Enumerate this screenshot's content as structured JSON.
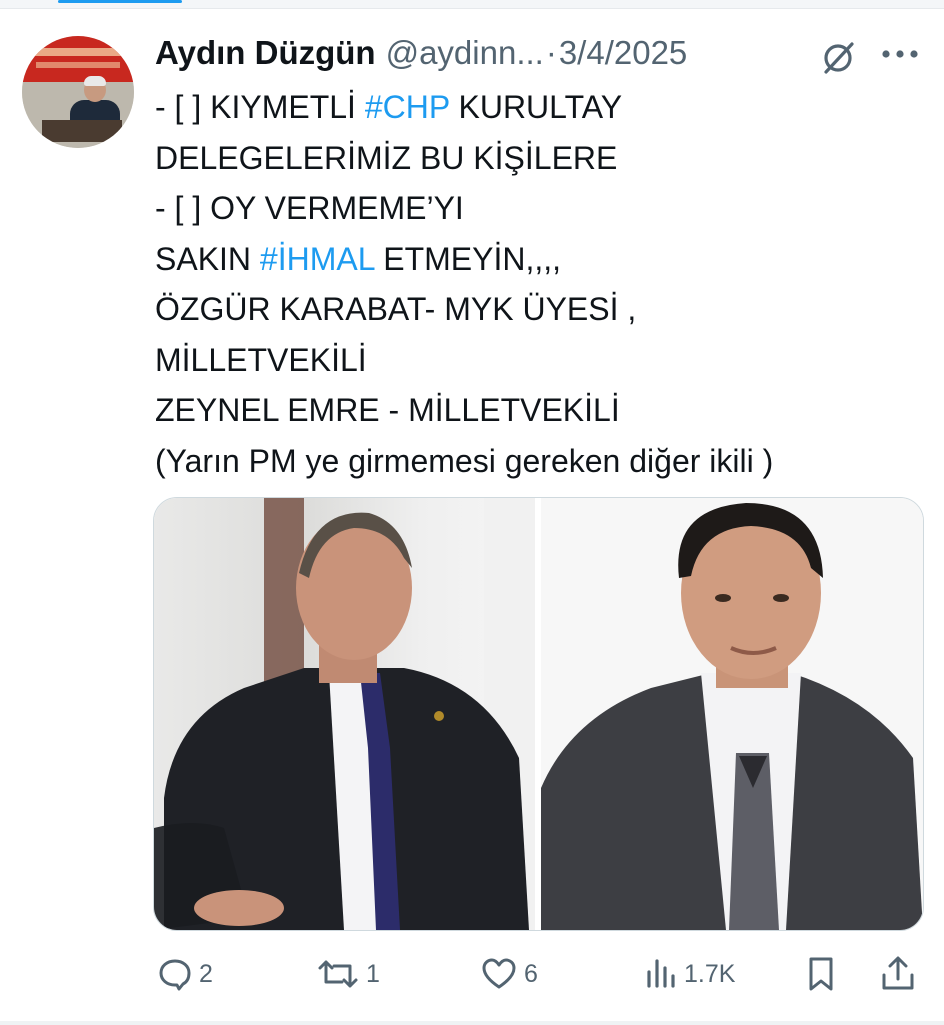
{
  "tweet": {
    "author_name": "Aydın Düzgün",
    "author_handle": "@aydinn...",
    "separator": "·",
    "date": "3/4/2025",
    "lines": [
      [
        "- [ ] KIYMETLİ ",
        {
          "tag": "#CHP"
        },
        " KURULTAY"
      ],
      [
        "DELEGELERİMİZ BU KİŞİLERE"
      ],
      [
        "- [ ] OY VERMEME’YI"
      ],
      [
        "SAKIN ",
        {
          "tag": "#İHMAL"
        },
        " ETMEYİN,,,,"
      ],
      [
        "ÖZGÜR KARABAT- MYK ÜYESİ ,"
      ],
      [
        "MİLLETVEKİLİ"
      ],
      [
        "ZEYNEL EMRE - MİLLETVEKİLİ"
      ],
      [
        "(Yarın PM ye girmemesi gereken diğer ikili )"
      ]
    ]
  },
  "actions": {
    "replies": "2",
    "reposts": "1",
    "likes": "6",
    "views": "1.7K"
  },
  "icons": {
    "reply": "reply-icon",
    "repost": "repost-icon",
    "like": "heart-icon",
    "views": "views-icon",
    "bookmark": "bookmark-icon",
    "share": "share-icon",
    "grok": "grok-icon",
    "more": "more-icon"
  },
  "colors": {
    "hashtag": "#1d9bf0",
    "secondary_text": "#536471",
    "primary_text": "#0f1419"
  }
}
